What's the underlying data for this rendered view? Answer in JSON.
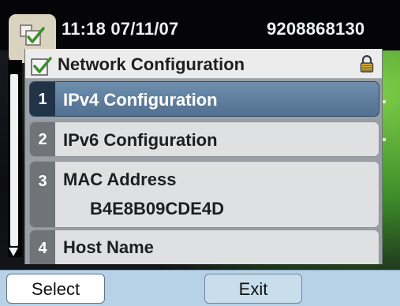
{
  "status_bar": {
    "time_date": "11:18 07/11/07",
    "phone_number": "9208868130"
  },
  "app": {
    "icon": "checkbox-settings-icon"
  },
  "panel": {
    "title": "Network Configuration",
    "lock_icon": "lock-icon",
    "items": [
      {
        "number": "1",
        "label": "IPv4 Configuration",
        "selected": true
      },
      {
        "number": "2",
        "label": "IPv6 Configuration",
        "selected": false
      },
      {
        "number": "3",
        "label": "MAC Address",
        "value": "B4E8B09CDE4D",
        "selected": false
      },
      {
        "number": "4",
        "label": "Host Name",
        "selected": false
      }
    ]
  },
  "softkeys": {
    "select": "Select",
    "exit": "Exit"
  },
  "colors": {
    "selected_item": "#5e7d9d",
    "softkey_bar": "#b7d2e6",
    "status_bar": "#050507"
  }
}
